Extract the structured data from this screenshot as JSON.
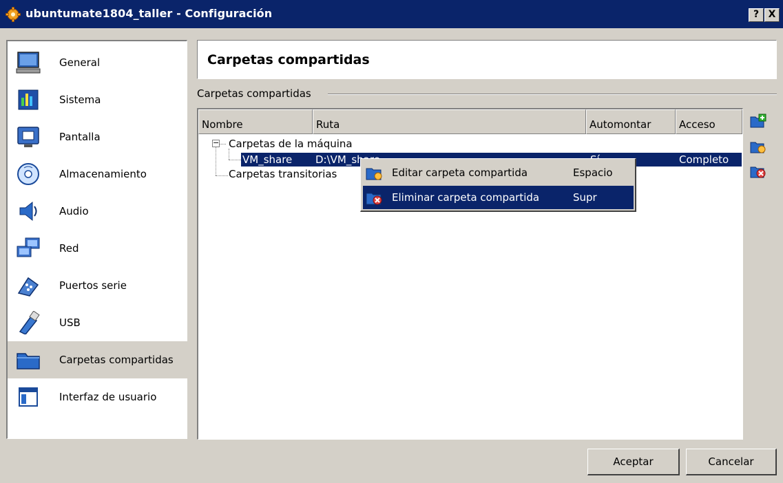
{
  "window": {
    "title": "ubuntumate1804_taller - Configuración",
    "help_label": "?",
    "close_label": "X",
    "accent": "#0a246a"
  },
  "sidebar": {
    "items": [
      {
        "label": "General",
        "icon": "monitor-icon"
      },
      {
        "label": "Sistema",
        "icon": "chip-icon"
      },
      {
        "label": "Pantalla",
        "icon": "display-icon"
      },
      {
        "label": "Almacenamiento",
        "icon": "disk-icon"
      },
      {
        "label": "Audio",
        "icon": "speaker-icon"
      },
      {
        "label": "Red",
        "icon": "network-icon"
      },
      {
        "label": "Puertos serie",
        "icon": "serial-port-icon"
      },
      {
        "label": "USB",
        "icon": "usb-icon"
      },
      {
        "label": "Carpetas compartidas",
        "icon": "folder-icon",
        "selected": true
      },
      {
        "label": "Interfaz de usuario",
        "icon": "ui-window-icon"
      }
    ]
  },
  "main": {
    "header_title": "Carpetas compartidas",
    "section_label": "Carpetas compartidas",
    "columns": [
      "Nombre",
      "Ruta",
      "Automontar",
      "Acceso"
    ],
    "tree": {
      "machine_group": "Carpetas de la máquina",
      "expander": "−",
      "share_row": {
        "name": "VM_share",
        "path": "D:\\VM_share",
        "automount": "Sí",
        "access": "Completo"
      },
      "transient_group": "Carpetas transitorias"
    }
  },
  "context_menu": {
    "items": [
      {
        "label": "Editar carpeta compartida",
        "shortcut": "Espacio"
      },
      {
        "label": "Eliminar carpeta compartida",
        "shortcut": "Supr"
      }
    ]
  },
  "footer": {
    "ok_label": "Aceptar",
    "cancel_label": "Cancelar"
  }
}
